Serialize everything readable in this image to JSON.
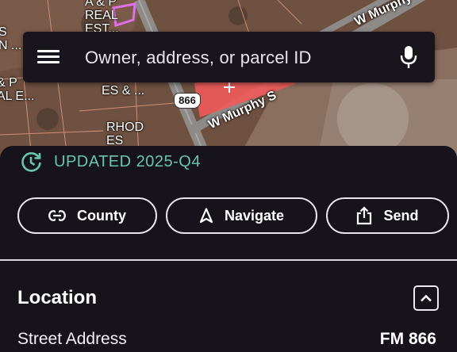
{
  "map": {
    "labels": {
      "ap_real": "A & P\nREAL\nEST...",
      "left_top": "S\nN ...",
      "left_bottom": "& P\nAL E...",
      "es": "ES & ...",
      "rhod": "RHOD\nES",
      "route_shield": "866",
      "street_main": "W Murphy S",
      "street_top": "W Murphy S"
    },
    "colors": {
      "parcel_highlight": "#f05a5a",
      "parcel_outline": "#e070e8"
    }
  },
  "search": {
    "placeholder": "Owner, address, or parcel ID",
    "menu_icon": "hamburger-menu-icon",
    "mic_icon": "microphone-icon"
  },
  "sheet": {
    "updated_text": "UPDATED 2025-Q4",
    "updated_icon": "refresh-clock-icon",
    "actions": [
      {
        "label": "County",
        "icon": "link-icon"
      },
      {
        "label": "Navigate",
        "icon": "navigation-arrow-icon"
      },
      {
        "label": "Send",
        "icon": "share-icon"
      }
    ],
    "section": {
      "title": "Location"
    },
    "rows": [
      {
        "label": "Street Address",
        "value": "FM 866"
      }
    ]
  },
  "colors": {
    "accent": "#69c4b1",
    "background": "#16131a",
    "text": "#ffffff"
  }
}
